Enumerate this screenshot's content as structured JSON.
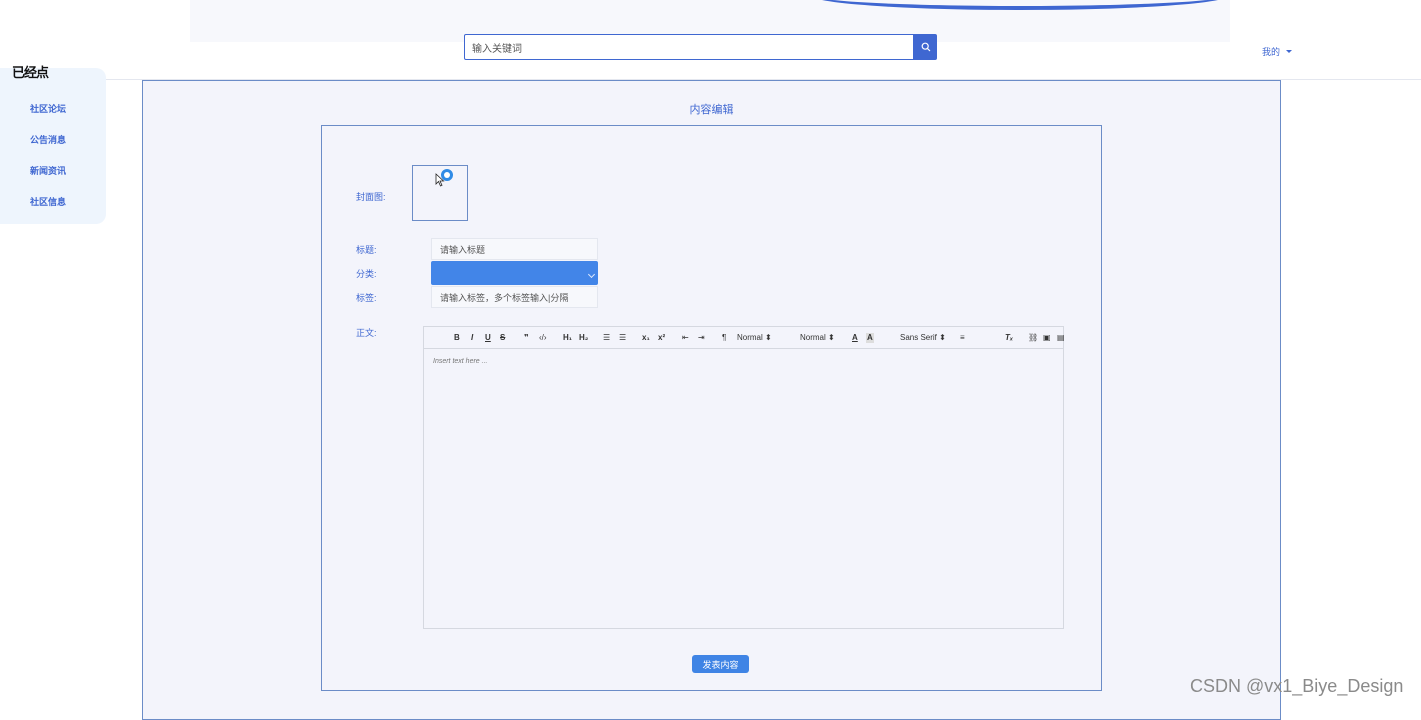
{
  "header": {
    "search_placeholder": "输入关键词",
    "user_menu_label": "我的"
  },
  "overlay_text": "已经点",
  "sidebar": {
    "items": [
      "社区论坛",
      "公告消息",
      "新闻资讯",
      "社区信息"
    ]
  },
  "main": {
    "title": "内容编辑",
    "form": {
      "cover_label": "封面图:",
      "title_label": "标题:",
      "title_placeholder": "请输入标题",
      "category_label": "分类:",
      "tags_label": "标签:",
      "tags_placeholder": "请输入标签，多个标签输入|分隔",
      "content_label": "正文:",
      "editor": {
        "header_select": "Normal ⬍",
        "size_select": "Normal ⬍",
        "font_select": "Sans Serif ⬍",
        "body_placeholder": "Insert text here ..."
      },
      "submit_label": "发表内容"
    }
  },
  "watermark": "CSDN @vx1_Biye_Design",
  "colors": {
    "accent": "#3f67d1",
    "select_fill": "#4285e8",
    "panel_bg": "#f3f4fb",
    "sidebar_bg": "#eef5fd"
  },
  "icons": [
    "search-icon",
    "caret-down-icon",
    "upload-icon",
    "cursor-icon"
  ]
}
